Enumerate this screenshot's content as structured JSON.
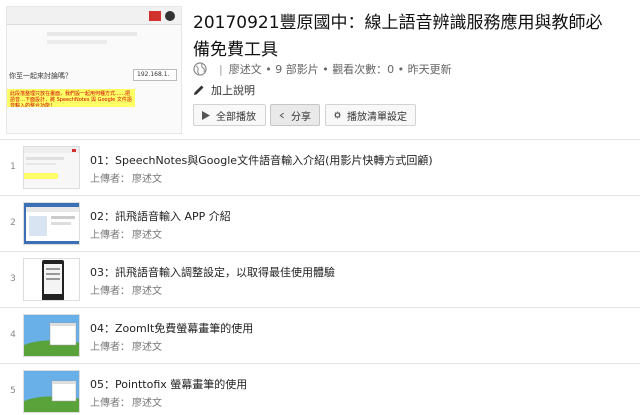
{
  "playlist": {
    "title": "20170921豐原國中：線上語音辨識服務應用與教師必備免費工具",
    "owner": "廖述文",
    "video_count": "9 部影片",
    "views": "觀看次數：0",
    "updated": "昨天更新",
    "add_description": "加上說明",
    "cover": {
      "heading": "你至一起來討論嗎？",
      "ip": "192.168.1.",
      "note": "此段落整理只放在畫面，我們設一起用何種方式……把語音…下面設計，將 SpeechNotes 與 Google 文件語音輸入的整合功能！"
    }
  },
  "buttons": {
    "play_all": "全部播放",
    "share": "分享",
    "settings": "播放清單設定"
  },
  "uploader_label": "上傳者：",
  "videos": [
    {
      "index": "1",
      "title": "01：SpeechNotes與Google文件語音輸入介紹(用影片快轉方式回顧)",
      "uploader": "廖述文"
    },
    {
      "index": "2",
      "title": "02：訊飛語音輸入 APP 介紹",
      "uploader": "廖述文"
    },
    {
      "index": "3",
      "title": "03：訊飛語音輸入調整設定，以取得最佳使用體驗",
      "uploader": "廖述文"
    },
    {
      "index": "4",
      "title": "04：ZoomIt免費螢幕畫筆的使用",
      "uploader": "廖述文"
    },
    {
      "index": "5",
      "title": "05：Pointtofix 螢幕畫筆的使用",
      "uploader": "廖述文"
    }
  ],
  "colors": {
    "accent_red": "#d0312d",
    "highlight_yellow": "#ffff66",
    "border": "#e2e2e2"
  }
}
